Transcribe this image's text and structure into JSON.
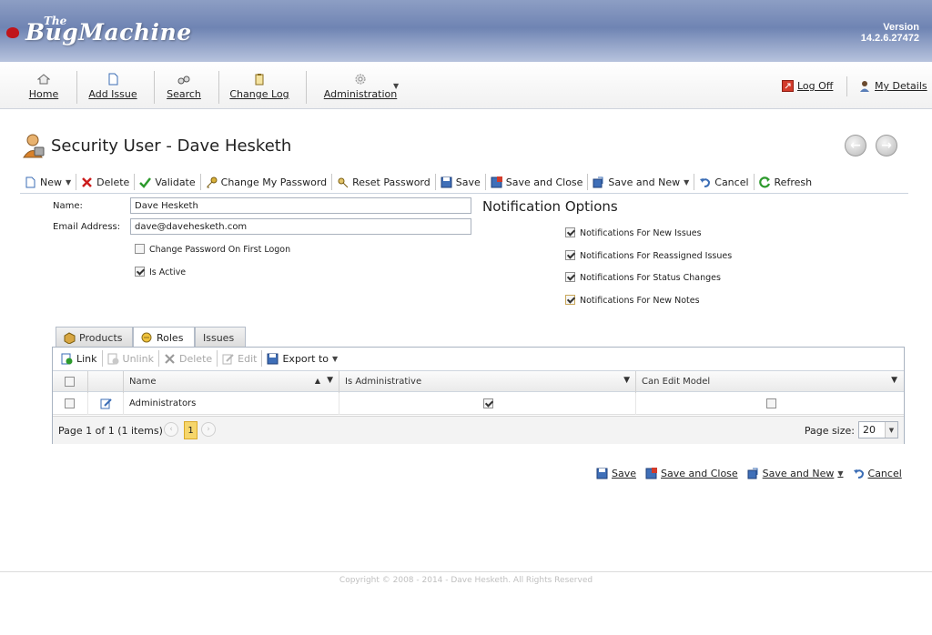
{
  "app": {
    "logo_the": "The",
    "logo_name": "BugMachine",
    "version_label": "Version",
    "version_number": "14.2.6.27472"
  },
  "menu": {
    "home": "Home",
    "add_issue": "Add Issue",
    "search": "Search",
    "change_log": "Change Log",
    "administration": "Administration",
    "log_off": "Log Off",
    "my_details": "My Details"
  },
  "page": {
    "title": "Security User - Dave Hesketh"
  },
  "toolbar": {
    "new": "New",
    "delete": "Delete",
    "validate": "Validate",
    "change_my_password": "Change My Password",
    "reset_password": "Reset Password",
    "save": "Save",
    "save_and_close": "Save and Close",
    "save_and_new": "Save and New",
    "cancel": "Cancel",
    "refresh": "Refresh"
  },
  "form": {
    "name_label": "Name:",
    "name_value": "Dave Hesketh",
    "email_label": "Email Address:",
    "email_value": "dave@davehesketh.com",
    "change_password_label": "Change Password On First Logon",
    "change_password_checked": false,
    "is_active_label": "Is Active",
    "is_active_checked": true
  },
  "notifications": {
    "title": "Notification Options",
    "options": [
      {
        "label": "Notifications For New Issues",
        "checked": true
      },
      {
        "label": "Notifications For Reassigned Issues",
        "checked": true
      },
      {
        "label": "Notifications For Status Changes",
        "checked": true
      },
      {
        "label": "Notifications For New Notes",
        "checked": true
      }
    ]
  },
  "tabs": [
    {
      "label": "Products",
      "icon": "box-icon"
    },
    {
      "label": "Roles",
      "icon": "roles-icon"
    },
    {
      "label": "Issues",
      "icon": ""
    }
  ],
  "grid": {
    "toolbar": {
      "link": "Link",
      "unlink": "Unlink",
      "delete": "Delete",
      "edit": "Edit",
      "export_to": "Export to"
    },
    "columns": [
      "Name",
      "Is Administrative",
      "Can Edit Model"
    ],
    "rows": [
      {
        "name": "Administrators",
        "is_administrative": true,
        "can_edit_model": false
      }
    ],
    "pager": {
      "summary": "Page 1 of 1 (1 items)",
      "current_page": "1",
      "page_size_label": "Page size:",
      "page_size": "20"
    }
  },
  "bottom_actions": {
    "save": "Save",
    "save_and_close": "Save and Close",
    "save_and_new": "Save and New",
    "cancel": "Cancel"
  },
  "footer": {
    "copyright": "Copyright © 2008 - 2014 - Dave Hesketh. All Rights Reserved"
  },
  "colors": {
    "banner": "#7f92bc",
    "accent_red": "#c0151b",
    "pager_current": "#f6d66b"
  }
}
